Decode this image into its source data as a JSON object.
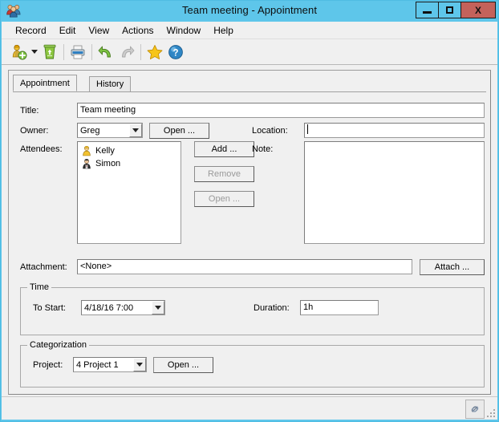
{
  "window": {
    "title": "Team meeting - Appointment",
    "app_icon": "people-group-icon",
    "controls": {
      "minimize": "minimize-icon",
      "maximize": "maximize-icon",
      "close": "X"
    }
  },
  "menubar": {
    "items": [
      {
        "label": "Record"
      },
      {
        "label": "Edit"
      },
      {
        "label": "View"
      },
      {
        "label": "Actions"
      },
      {
        "label": "Window"
      },
      {
        "label": "Help"
      }
    ]
  },
  "toolbar": {
    "buttons": [
      {
        "name": "new-record-icon",
        "enabled": true
      },
      {
        "name": "dropdown-caret-icon",
        "enabled": true
      },
      {
        "name": "delete-recycle-bin-icon",
        "enabled": true
      },
      {
        "name": "print-icon",
        "enabled": true
      },
      {
        "name": "undo-icon",
        "enabled": true
      },
      {
        "name": "redo-icon",
        "enabled": false
      },
      {
        "name": "favorite-star-icon",
        "enabled": true
      },
      {
        "name": "help-icon",
        "enabled": true
      }
    ]
  },
  "tabs": [
    {
      "label": "Appointment",
      "active": true
    },
    {
      "label": "History",
      "active": false
    }
  ],
  "form": {
    "title": {
      "label": "Title:",
      "value": "Team meeting"
    },
    "owner": {
      "label": "Owner:",
      "value": "Greg",
      "button": "Open ..."
    },
    "location": {
      "label": "Location:",
      "value": "",
      "focused": true
    },
    "attendees": {
      "label": "Attendees:",
      "items": [
        {
          "name": "Kelly",
          "icon": "person-yellow-icon"
        },
        {
          "name": "Simon",
          "icon": "person-dark-icon"
        }
      ],
      "buttons": [
        {
          "label": "Add ...",
          "enabled": true
        },
        {
          "label": "Remove",
          "enabled": false
        },
        {
          "label": "Open ...",
          "enabled": false
        }
      ]
    },
    "note": {
      "label": "Note:",
      "value": ""
    },
    "attachment": {
      "label": "Attachment:",
      "value": "<None>",
      "button": "Attach ..."
    },
    "time": {
      "group_title": "Time",
      "to_start": {
        "label": "To Start:",
        "value": "4/18/16  7:00"
      },
      "duration": {
        "label": "Duration:",
        "value": "1h"
      }
    },
    "categorization": {
      "group_title": "Categorization",
      "project": {
        "label": "Project:",
        "value": "4 Project 1",
        "button": "Open ..."
      }
    }
  },
  "statusbar": {
    "link_icon": "chain-link-icon",
    "resize_grip": "resize-grip-icon"
  },
  "colors": {
    "window_frame": "#5ec6ea",
    "close_button": "#c4625b",
    "client_bg": "#f0f0f0",
    "field_bg": "#ffffff"
  }
}
